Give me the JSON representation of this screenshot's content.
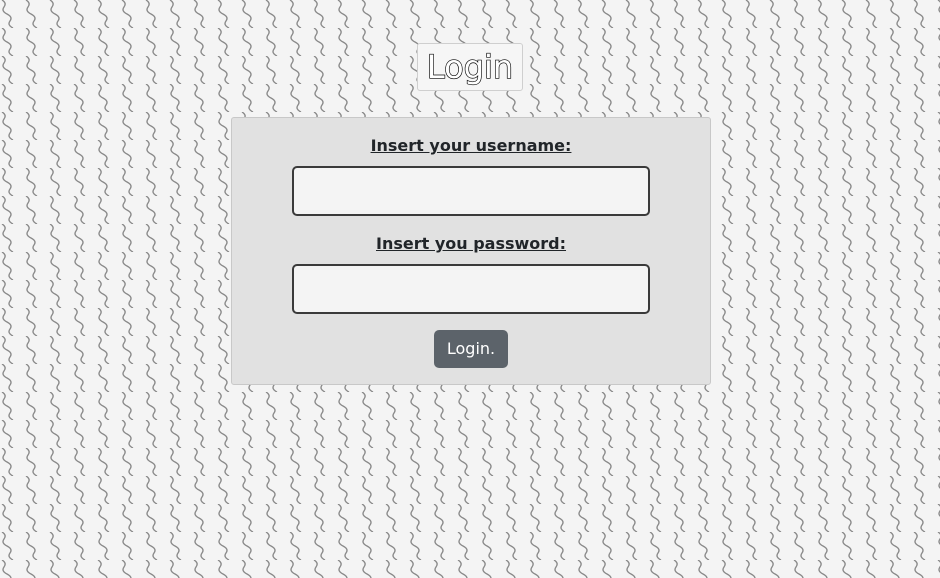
{
  "page": {
    "title": "Login"
  },
  "form": {
    "username_label": "Insert your username:",
    "username_value": "",
    "password_label": "Insert you password:",
    "password_value": "",
    "submit_label": "Login."
  },
  "colors": {
    "background": "#f4f4f4",
    "pattern": "#8a8a8a",
    "panel": "#e1e1e1",
    "button": "#5c636a",
    "button_text": "#ffffff"
  }
}
